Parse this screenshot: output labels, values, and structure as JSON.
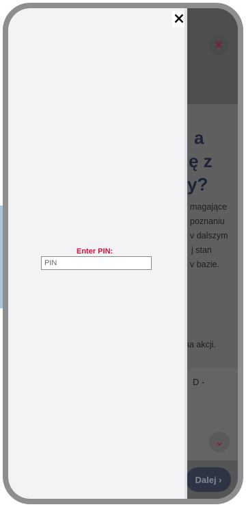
{
  "background_page": {
    "close_icon": "close-icon",
    "heading_lines": [
      "a",
      "ę z",
      "y?"
    ],
    "paragraph_lines": [
      "magające",
      "poznaniu",
      "v dalszym",
      "j stan",
      "v bazie."
    ],
    "second_text": "na akcji.",
    "card_text": "D -",
    "chevron_icon": "chevron-down-icon",
    "next_button_label": "Dalej ›"
  },
  "pin_dialog": {
    "close_label": "×",
    "label": "Enter PIN:",
    "placeholder": "PIN",
    "value": ""
  },
  "colors": {
    "accent_red": "#d0103a",
    "overlay_bg": "#f3f3f6",
    "side_tab": "#a9c6e0"
  }
}
